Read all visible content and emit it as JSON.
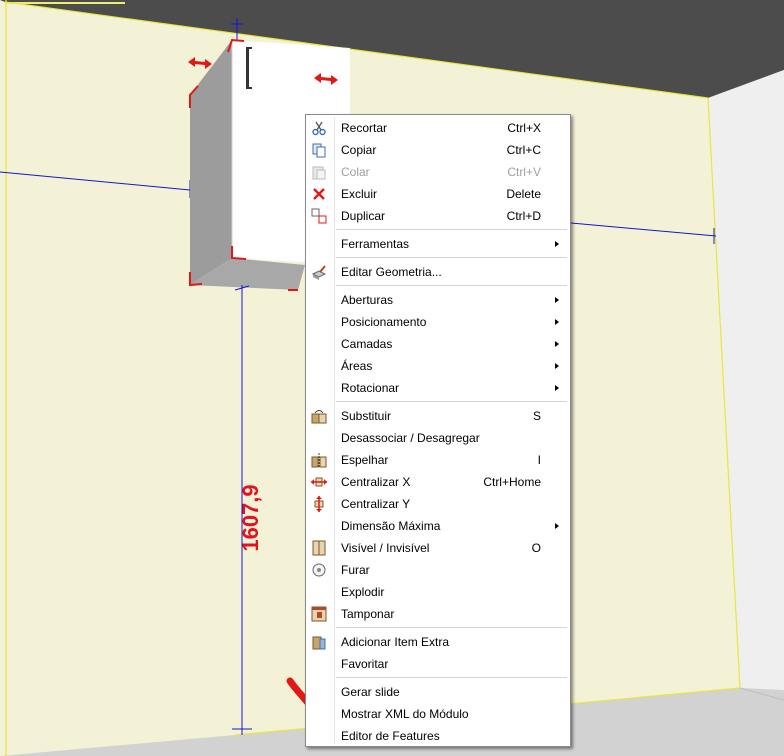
{
  "scene": {
    "dimension_label": "1607,9",
    "colors": {
      "wall": "#f4f2d6",
      "ceiling": "#4a4a4a",
      "side_wall": "#f2f2f2",
      "dim_line": "#1414d2",
      "dim_text": "#e0141e",
      "arrow": "#e01818"
    }
  },
  "menu": {
    "items": [
      {
        "type": "item",
        "label": "Recortar",
        "shortcut": "Ctrl+X",
        "icon": "scissors-icon"
      },
      {
        "type": "item",
        "label": "Copiar",
        "shortcut": "Ctrl+C",
        "icon": "copy-icon"
      },
      {
        "type": "item",
        "label": "Colar",
        "shortcut": "Ctrl+V",
        "icon": "paste-icon",
        "disabled": true
      },
      {
        "type": "item",
        "label": "Excluir",
        "shortcut": "Delete",
        "icon": "delete-icon"
      },
      {
        "type": "item",
        "label": "Duplicar",
        "shortcut": "Ctrl+D",
        "icon": "duplicate-icon"
      },
      {
        "type": "sep"
      },
      {
        "type": "item",
        "label": "Ferramentas",
        "submenu": true
      },
      {
        "type": "sep"
      },
      {
        "type": "item",
        "label": "Editar Geometria...",
        "icon": "edit-geometry-icon"
      },
      {
        "type": "sep"
      },
      {
        "type": "item",
        "label": "Aberturas",
        "submenu": true
      },
      {
        "type": "item",
        "label": "Posicionamento",
        "submenu": true
      },
      {
        "type": "item",
        "label": "Camadas",
        "submenu": true
      },
      {
        "type": "item",
        "label": "Áreas",
        "submenu": true
      },
      {
        "type": "item",
        "label": "Rotacionar",
        "submenu": true
      },
      {
        "type": "sep"
      },
      {
        "type": "item",
        "label": "Substituir",
        "shortcut": "S",
        "icon": "replace-icon"
      },
      {
        "type": "item",
        "label": "Desassociar / Desagregar"
      },
      {
        "type": "item",
        "label": "Espelhar",
        "shortcut": "I",
        "icon": "mirror-icon"
      },
      {
        "type": "item",
        "label": "Centralizar X",
        "shortcut": "Ctrl+Home",
        "icon": "center-x-icon"
      },
      {
        "type": "item",
        "label": "Centralizar Y",
        "icon": "center-y-icon"
      },
      {
        "type": "item",
        "label": "Dimensão Máxima",
        "submenu": true
      },
      {
        "type": "item",
        "label": "Visível / Invisível",
        "shortcut": "O",
        "icon": "visibility-icon"
      },
      {
        "type": "item",
        "label": "Furar",
        "icon": "drill-icon"
      },
      {
        "type": "item",
        "label": "Explodir"
      },
      {
        "type": "item",
        "label": "Tamponar",
        "icon": "cover-icon"
      },
      {
        "type": "sep"
      },
      {
        "type": "item",
        "label": "Adicionar Item Extra",
        "icon": "extra-item-icon"
      },
      {
        "type": "item",
        "label": "Favoritar"
      },
      {
        "type": "sep"
      },
      {
        "type": "item",
        "label": "Gerar slide"
      },
      {
        "type": "item",
        "label": "Mostrar XML do Módulo"
      },
      {
        "type": "item",
        "label": "Editor de Features"
      }
    ]
  }
}
